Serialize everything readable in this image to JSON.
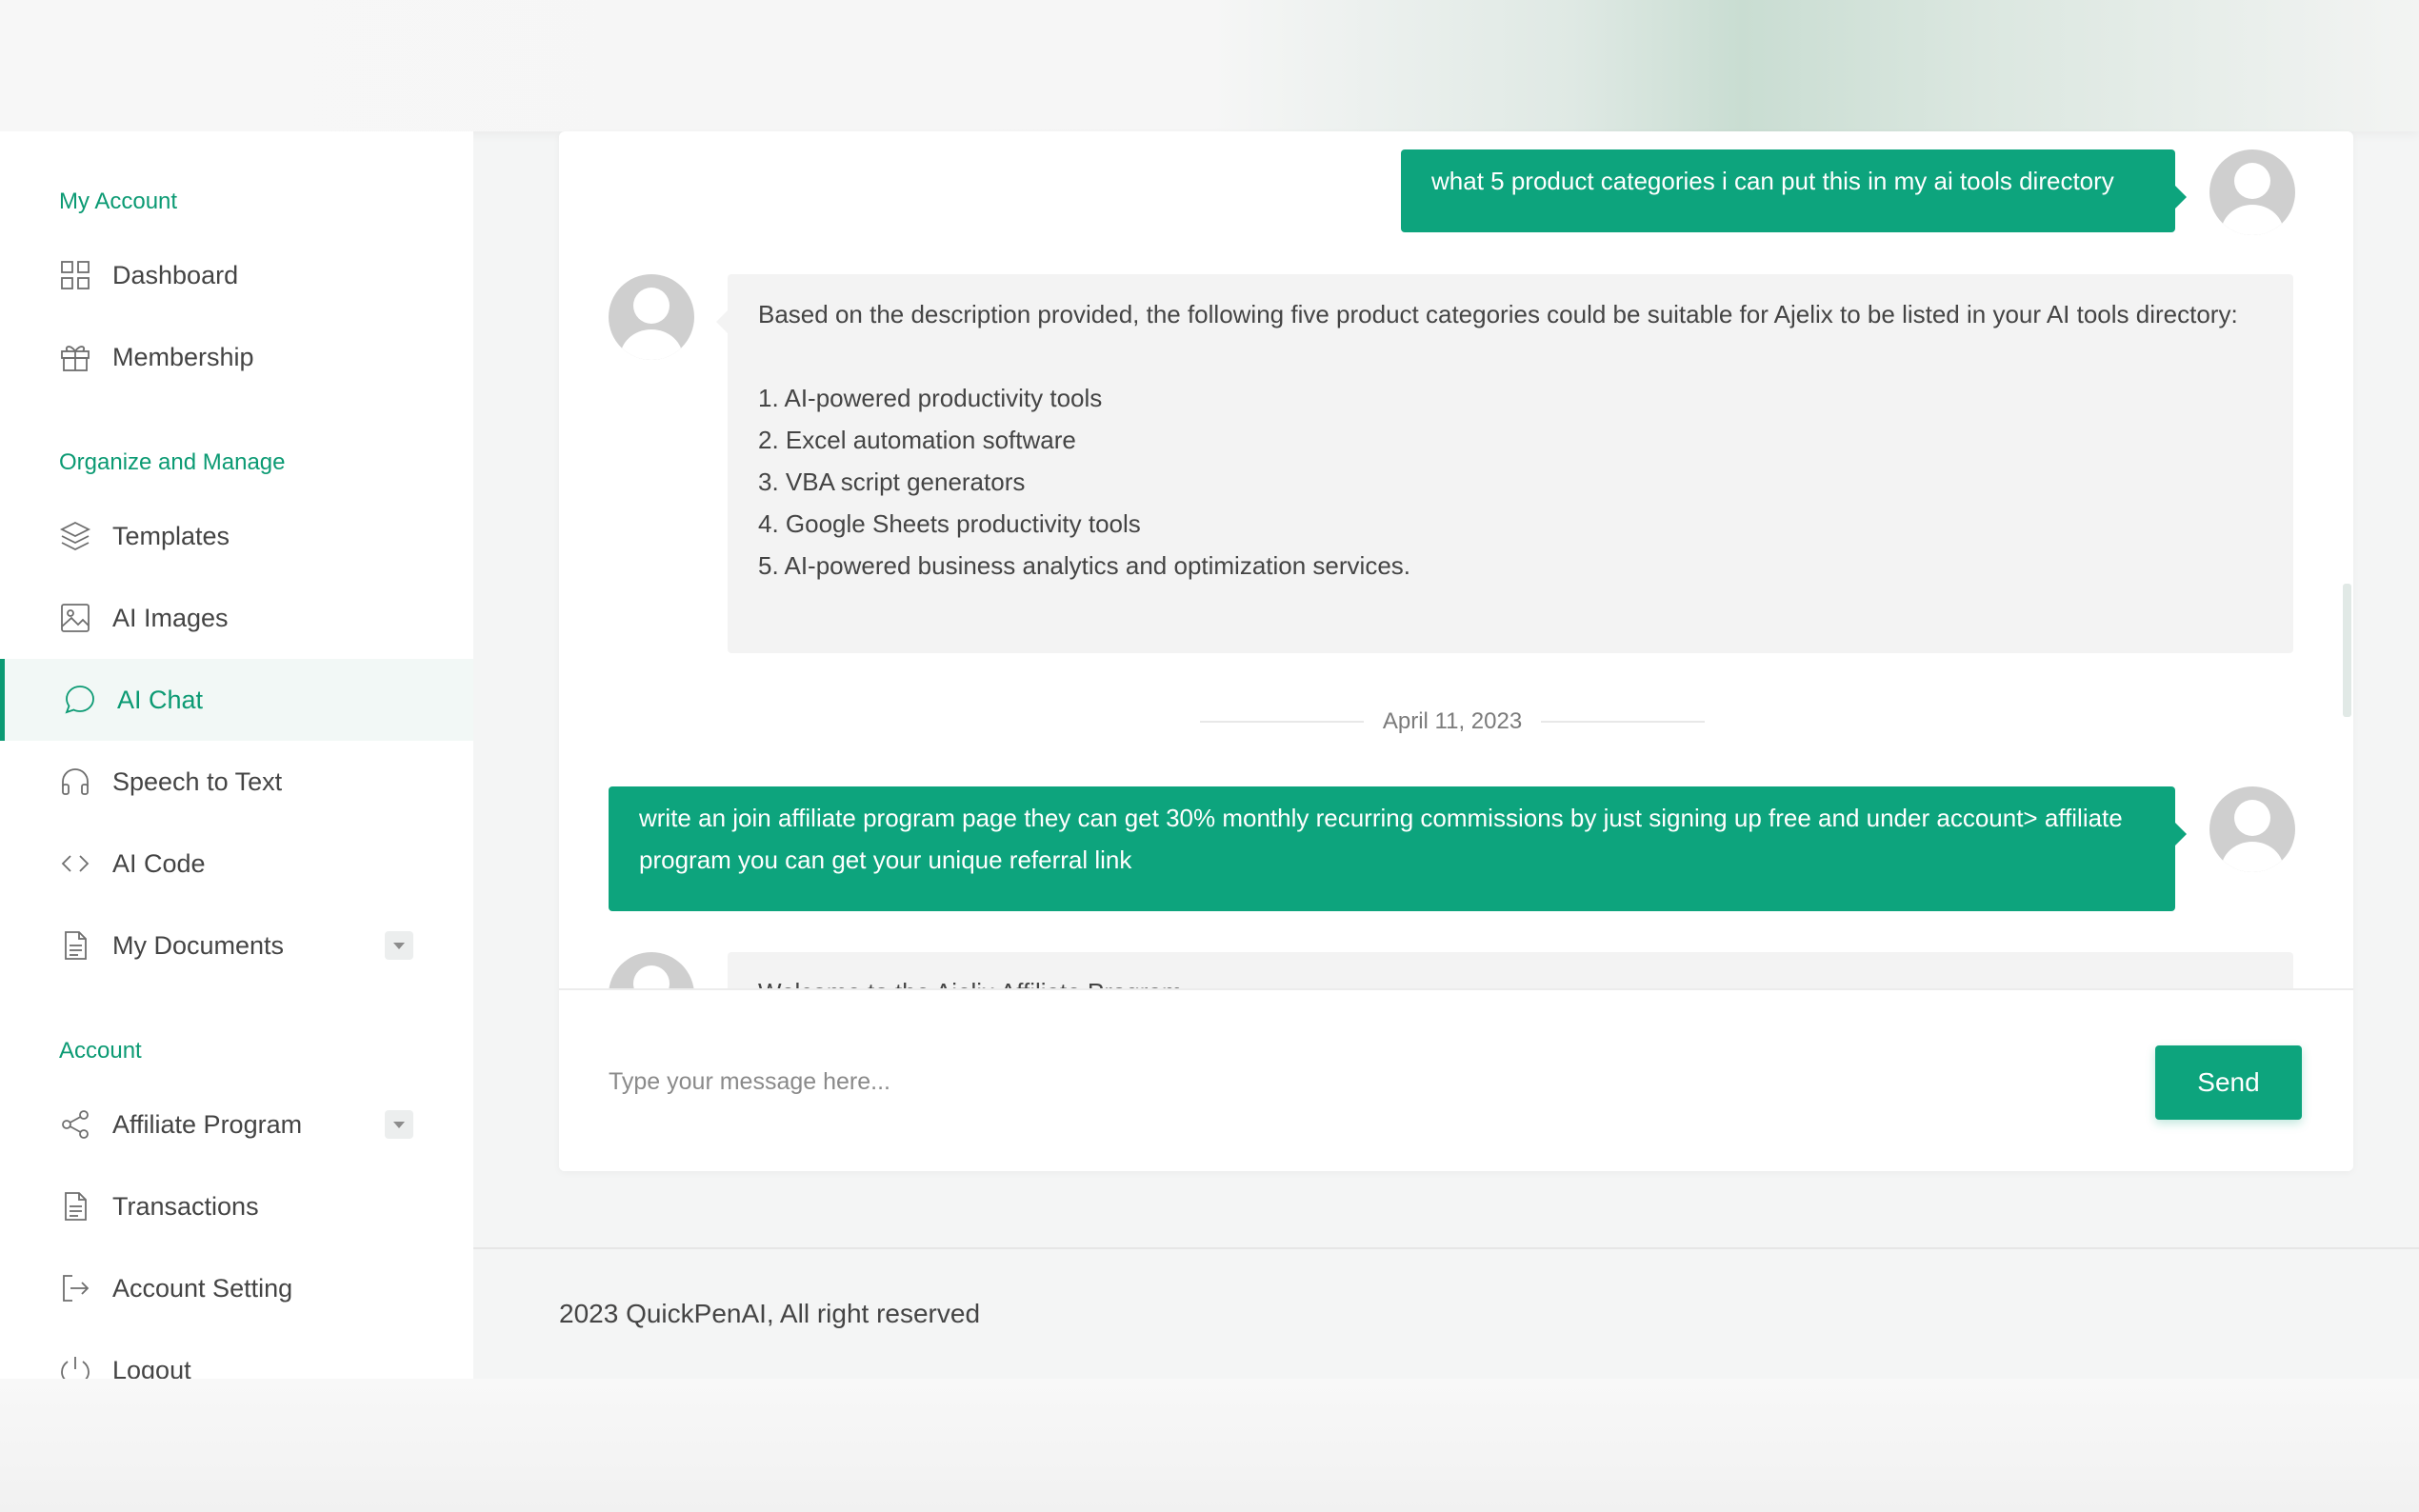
{
  "sidebar": {
    "sections": [
      {
        "heading": "My Account",
        "items": [
          {
            "label": "Dashboard",
            "icon": "grid-icon"
          },
          {
            "label": "Membership",
            "icon": "gift-icon"
          }
        ]
      },
      {
        "heading": "Organize and Manage",
        "items": [
          {
            "label": "Templates",
            "icon": "layers-icon"
          },
          {
            "label": "AI Images",
            "icon": "image-icon"
          },
          {
            "label": "AI Chat",
            "icon": "chat-bubble-icon",
            "active": true
          },
          {
            "label": "Speech to Text",
            "icon": "headphones-icon"
          },
          {
            "label": "AI Code",
            "icon": "code-icon"
          },
          {
            "label": "My Documents",
            "icon": "document-icon",
            "has_dropdown": true
          }
        ]
      },
      {
        "heading": "Account",
        "items": [
          {
            "label": "Affiliate Program",
            "icon": "share-icon",
            "has_dropdown": true
          },
          {
            "label": "Transactions",
            "icon": "document-icon"
          },
          {
            "label": "Account Setting",
            "icon": "sign-out-arrow-icon"
          },
          {
            "label": "Logout",
            "icon": "power-icon"
          }
        ]
      }
    ]
  },
  "chat": {
    "messages": [
      {
        "role": "user",
        "text": "what 5 product categories i can put this in my ai tools directory"
      },
      {
        "role": "assistant",
        "intro": "Based on the description provided, the following five product categories could be suitable for Ajelix to be listed in your AI tools directory:",
        "list": [
          "1. AI-powered productivity tools",
          "2. Excel automation software",
          "3. VBA script generators",
          "4. Google Sheets productivity tools",
          "5. AI-powered business analytics and optimization services."
        ]
      },
      {
        "role": "date",
        "text": "April 11, 2023"
      },
      {
        "role": "user",
        "text": "write an join affiliate program page they can get 30% monthly recurring commissions by just signing up free and under account> affiliate program you can get your unique referral link"
      },
      {
        "role": "assistant",
        "text": "Welcome to the Ajelix Affiliate Program"
      }
    ],
    "composer": {
      "placeholder": "Type your message here...",
      "send_label": "Send"
    }
  },
  "footer": {
    "text": "2023 QuickPenAI, All right reserved"
  },
  "colors": {
    "accent": "#0da47d",
    "bot_bubble": "#f3f3f3",
    "sidebar_active_bg": "#f2f8f6"
  }
}
